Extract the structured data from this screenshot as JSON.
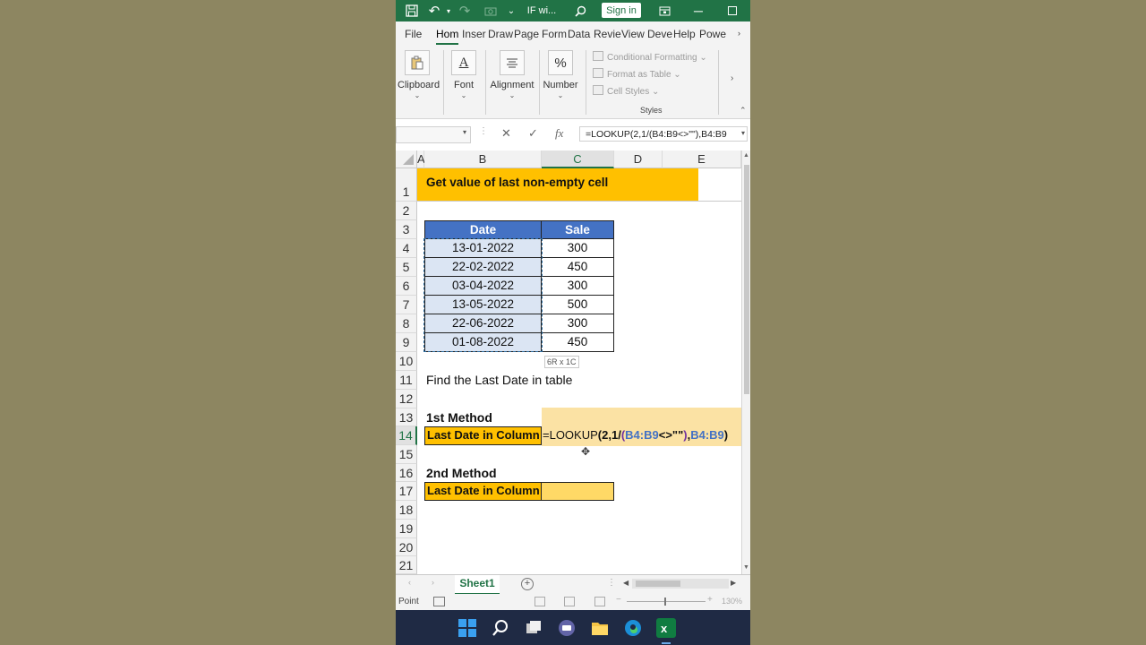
{
  "titlebar": {
    "filename": "IF wi...",
    "signin": "Sign in"
  },
  "ribbon_tabs": [
    "File",
    "Hom",
    "Inser",
    "Draw",
    "Page",
    "Form",
    "Data",
    "Revie",
    "View",
    "Deve",
    "Help",
    "Powe"
  ],
  "ribbon": {
    "clipboard": "Clipboard",
    "font": "Font",
    "alignment": "Alignment",
    "number": "Number",
    "conditional_formatting": "Conditional Formatting",
    "format_as_table": "Format as Table",
    "cell_styles": "Cell Styles",
    "styles_group": "Styles"
  },
  "formula_bar": {
    "formula": "=LOOKUP(2,1/(B4:B9<>\"\"),B4:B9"
  },
  "columns": [
    "A",
    "B",
    "C",
    "D",
    "E"
  ],
  "rows": [
    "1",
    "2",
    "3",
    "4",
    "5",
    "6",
    "7",
    "8",
    "9",
    "10",
    "11",
    "12",
    "13",
    "14",
    "15",
    "16",
    "17",
    "18",
    "19",
    "20",
    "21"
  ],
  "sheet": {
    "title": "Get value of last non-empty cell",
    "header_date": "Date",
    "header_sale": "Sale",
    "table": [
      {
        "date": "13-01-2022",
        "sale": "300"
      },
      {
        "date": "22-02-2022",
        "sale": "450"
      },
      {
        "date": "03-04-2022",
        "sale": "300"
      },
      {
        "date": "13-05-2022",
        "sale": "500"
      },
      {
        "date": "22-06-2022",
        "sale": "300"
      },
      {
        "date": "01-08-2022",
        "sale": "450"
      }
    ],
    "selection_tip": "6R x 1C",
    "find_text": "Find the Last Date in table",
    "method1": "1st Method",
    "method2": "2nd Method",
    "last_date_label": "Last Date in Column",
    "edit_formula": {
      "p1": "=LOOKUP",
      "p2": "(",
      "p3": "2,1/",
      "p4": "(",
      "p5": "B4:B9",
      "p6": "<>\"\"",
      "p7": ")",
      "p8": ",",
      "p9": "B4:B9",
      "p10": ")"
    }
  },
  "sheet_tab": "Sheet1",
  "status": {
    "mode": "Point",
    "zoom": "130%"
  },
  "colors": {
    "excel_green": "#217346",
    "header_blue": "#4472c4",
    "orange": "#ffc000",
    "ref_blue": "#4472c4",
    "ref_purple": "#7030a0"
  }
}
